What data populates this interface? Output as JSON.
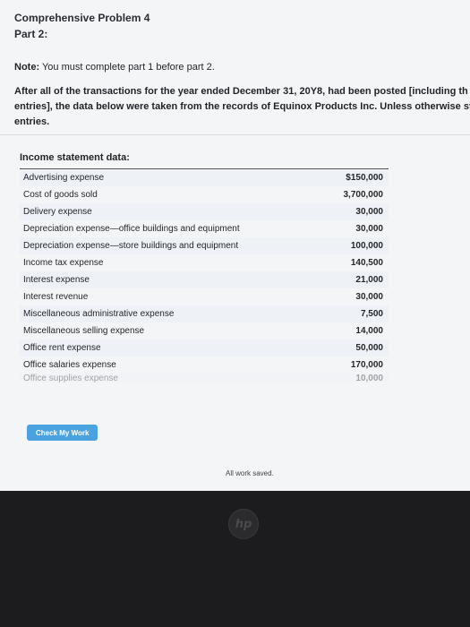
{
  "header": {
    "title": "Comprehensive Problem 4",
    "part": "Part 2:"
  },
  "note": {
    "label": "Note:",
    "text": "You must complete part 1 before part 2."
  },
  "intro": {
    "line1": "After all of the transactions for the year ended December 31, 20Y8, had been posted [including th",
    "line2": "entries], the data below were taken from the records of Equinox Products Inc. Unless otherwise sta",
    "line3": "entries."
  },
  "table": {
    "heading": "Income statement data:",
    "rows": [
      {
        "label": "Advertising expense",
        "value": "$150,000"
      },
      {
        "label": "Cost of goods sold",
        "value": "3,700,000"
      },
      {
        "label": "Delivery expense",
        "value": "30,000"
      },
      {
        "label": "Depreciation expense—office buildings and equipment",
        "value": "30,000"
      },
      {
        "label": "Depreciation expense—store buildings and equipment",
        "value": "100,000"
      },
      {
        "label": "Income tax expense",
        "value": "140,500"
      },
      {
        "label": "Interest expense",
        "value": "21,000"
      },
      {
        "label": "Interest revenue",
        "value": "30,000"
      },
      {
        "label": "Miscellaneous administrative expense",
        "value": "7,500"
      },
      {
        "label": "Miscellaneous selling expense",
        "value": "14,000"
      },
      {
        "label": "Office rent expense",
        "value": "50,000"
      },
      {
        "label": "Office salaries expense",
        "value": "170,000"
      },
      {
        "label": "Office supplies expense",
        "value": "10,000"
      }
    ]
  },
  "actions": {
    "check_label": "Check My Work"
  },
  "status": {
    "saved": "All work saved."
  },
  "device": {
    "logo": "hp"
  },
  "colors": {
    "button": "#4aa3e0",
    "page_bg": "#f4f5f7",
    "bezel": "#1c1b1d"
  }
}
